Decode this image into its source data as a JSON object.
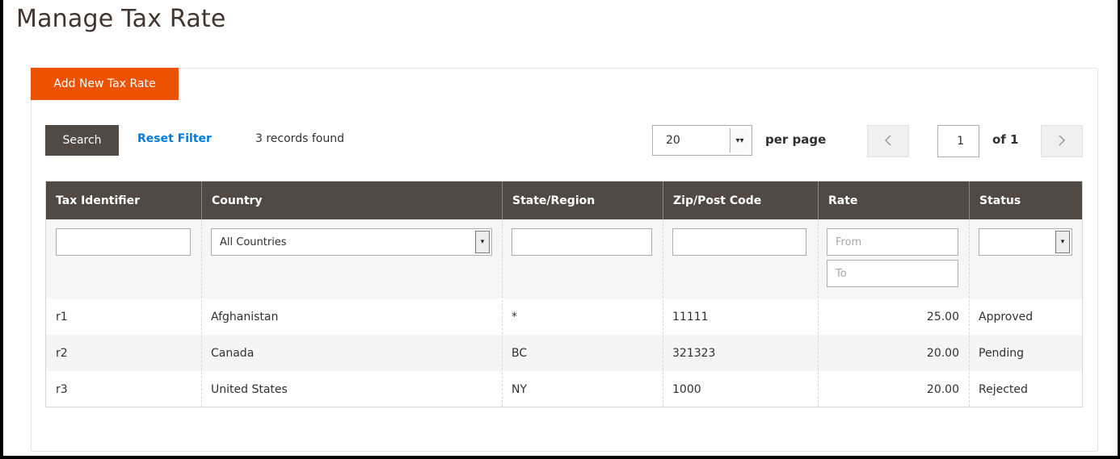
{
  "page": {
    "title": "Manage Tax Rate"
  },
  "actions": {
    "add_label": "Add New Tax Rate",
    "search_label": "Search",
    "reset_label": "Reset Filter",
    "records_found": "3 records found"
  },
  "pager": {
    "per_page_value": "20",
    "per_page_label": "per page",
    "prev_icon": "chevron-left-icon",
    "next_icon": "chevron-right-icon",
    "current_page": "1",
    "of_label": "of 1"
  },
  "grid": {
    "columns": [
      "Tax Identifier",
      "Country",
      "State/Region",
      "Zip/Post Code",
      "Rate",
      "Status"
    ],
    "filters": {
      "tax_identifier": "",
      "country": "All Countries",
      "state": "",
      "zip": "",
      "rate_from_placeholder": "From",
      "rate_to_placeholder": "To",
      "status": ""
    },
    "rows": [
      {
        "id": "r1",
        "country": "Afghanistan",
        "state": "*",
        "zip": "11111",
        "rate": "25.00",
        "status": "Approved"
      },
      {
        "id": "r2",
        "country": "Canada",
        "state": "BC",
        "zip": "321323",
        "rate": "20.00",
        "status": "Pending"
      },
      {
        "id": "r3",
        "country": "United States",
        "state": "NY",
        "zip": "1000",
        "rate": "20.00",
        "status": "Rejected"
      }
    ]
  },
  "colors": {
    "accent": "#eb5202",
    "header_bg": "#514943",
    "link": "#007bdb"
  }
}
